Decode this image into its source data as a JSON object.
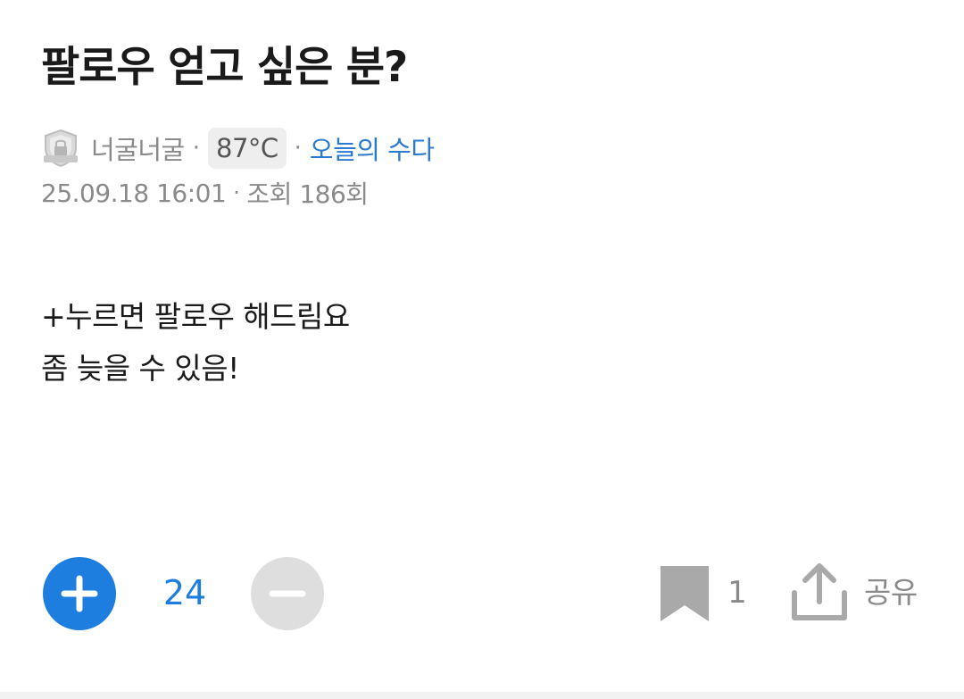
{
  "post": {
    "title": "팔로우 얻고 싶은 분?",
    "author": {
      "name": "너굴너굴",
      "badge_icon": "badge-shield-icon",
      "temperature": "87°C"
    },
    "board": "오늘의 수다",
    "date": "25.09.18 16:01",
    "views": "조회 186회",
    "separator": "·",
    "body": [
      "+누르면 팔로우 해드림요",
      "좀 늦을 수 있음!"
    ]
  },
  "actions": {
    "upvote_icon": "plus-icon",
    "vote_count": "24",
    "downvote_icon": "minus-icon",
    "bookmark_icon": "bookmark-icon",
    "bookmark_count": "1",
    "share_icon": "share-upload-icon",
    "share_label": "공유"
  },
  "colors": {
    "accent": "#1e7ee0",
    "link": "#2a7ad0",
    "muted_text": "#8a8a8a",
    "disabled_button": "#dedede",
    "temp_badge_bg": "#eeeeee"
  }
}
